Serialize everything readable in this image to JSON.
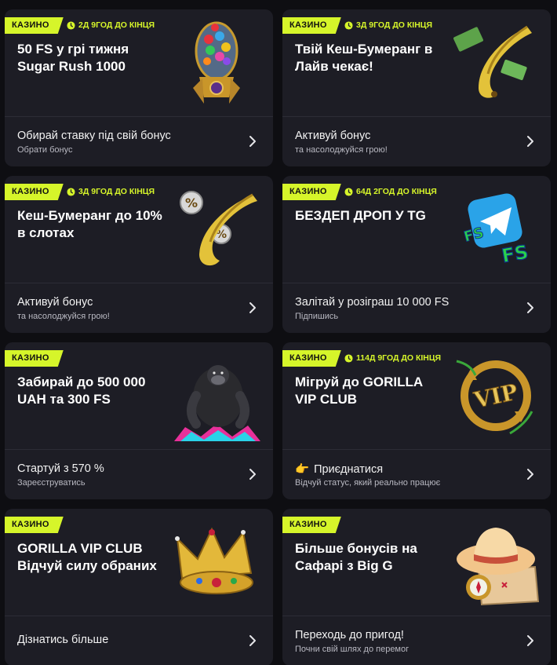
{
  "colors": {
    "accent": "#d6f52a",
    "card_bg": "#1d1d25",
    "page_bg": "#0e0e12"
  },
  "cards": [
    {
      "badge": "КАЗИНО",
      "timer": "2Д 9ГОД ДО КІНЦЯ",
      "title": "50 FS у грі тижня Sugar Rush 1000",
      "cta": "Обирай ставку під свій бонус",
      "sub": "Обрати бонус",
      "art": "candy-rocket-icon"
    },
    {
      "badge": "КАЗИНО",
      "timer": "3Д 9ГОД ДО КІНЦЯ",
      "title": "Твій Кеш-Бумеранг в Лайв чекає!",
      "cta": "Активуй бонус",
      "sub": "та насолоджуйся грою!",
      "art": "banana-boomerang-cash-icon"
    },
    {
      "badge": "КАЗИНО",
      "timer": "3Д 9ГОД ДО КІНЦЯ",
      "title": "Кеш-Бумеранг до 10% в слотах",
      "cta": "Активуй бонус",
      "sub": "та насолоджуйся грою!",
      "art": "banana-boomerang-percent-icon"
    },
    {
      "badge": "КАЗИНО",
      "timer": "64Д 2ГОД ДО КІНЦЯ",
      "title": "БЕЗДЕП ДРОП У TG",
      "cta": "Залітай у розіграш 10 000 FS",
      "sub": "Підпишись",
      "art": "telegram-fs-icon"
    },
    {
      "badge": "КАЗИНО",
      "timer": "",
      "title": "Забирай до 500 000 UAH та 300 FS",
      "cta": "Стартуй з 570 %",
      "sub": "Зареєструватись",
      "art": "gorilla-icon"
    },
    {
      "badge": "КАЗИНО",
      "timer": "114Д 9ГОД ДО КІНЦЯ",
      "title": "Мігруй до GORILLA VIP CLUB",
      "cta": "Приєднатися",
      "cta_emoji": "👉",
      "sub": "Відчуй статус, який реально працює",
      "art": "vip-emblem-icon"
    },
    {
      "badge": "КАЗИНО",
      "timer": "",
      "title": "GORILLA VIP CLUB Відчуй силу обраних",
      "cta": "Дізнатись більше",
      "sub": "",
      "art": "crown-icon"
    },
    {
      "badge": "КАЗИНО",
      "timer": "",
      "title": "Більше бонусів на Сафарі з Big G",
      "cta": "Переходь до пригод!",
      "sub": "Почни свій шлях до перемог",
      "art": "safari-hat-icon"
    }
  ]
}
